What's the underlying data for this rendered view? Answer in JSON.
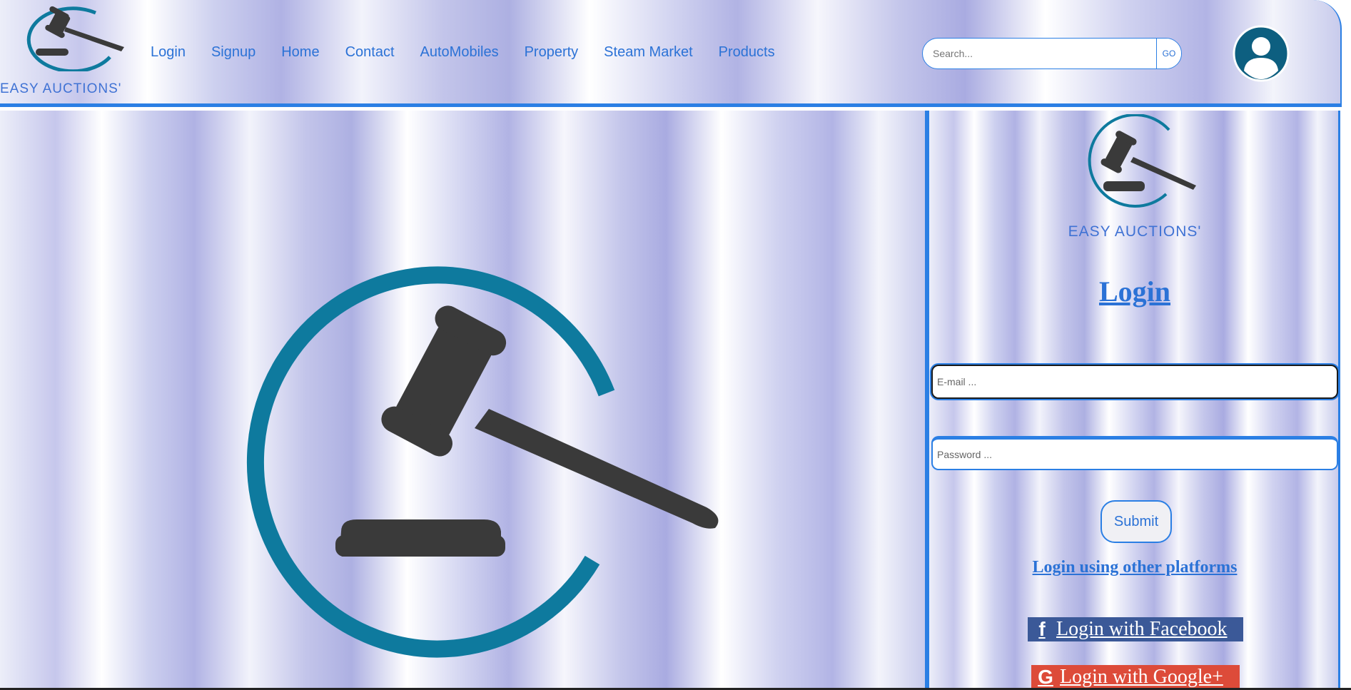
{
  "brand": {
    "name": "EASY AUCTIONS'"
  },
  "nav": {
    "items": [
      "Login",
      "Signup",
      "Home",
      "Contact",
      "AutoMobiles",
      "Property",
      "Steam Market",
      "Products"
    ]
  },
  "search": {
    "placeholder": "Search...",
    "button_label": "GO"
  },
  "login_panel": {
    "brand_name": "EASY AUCTIONS'",
    "title": "Login",
    "email_placeholder": "E-mail ...",
    "password_placeholder": "Password ...",
    "submit_label": "Submit",
    "other_platforms_label": "Login using other platforms",
    "facebook_label": "Login with Facebook",
    "google_label": "Login with Google+"
  },
  "colors": {
    "accent": "#2b7fe4",
    "text_link": "#2b72d6",
    "logo_teal": "#0e7a9e",
    "gavel": "#3a3a3a",
    "facebook": "#3b5998",
    "google": "#dd4b39"
  },
  "icons": [
    "gavel-logo",
    "user-avatar-icon",
    "facebook-icon",
    "google-icon"
  ]
}
